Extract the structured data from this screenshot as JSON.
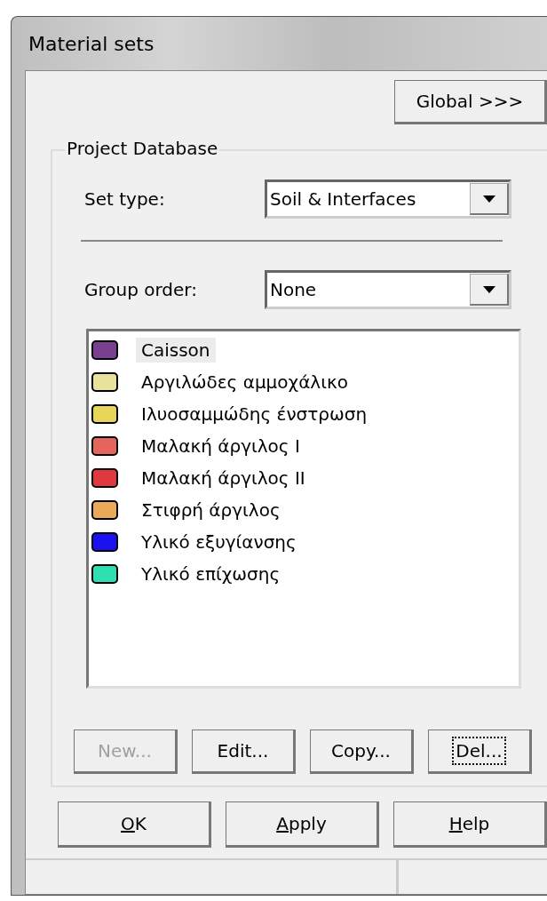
{
  "window": {
    "title": "Material sets"
  },
  "global_button": {
    "label": "Global >>>"
  },
  "group": {
    "title": "Project Database"
  },
  "set_type": {
    "label": "Set type:",
    "value": "Soil & Interfaces"
  },
  "group_order": {
    "label": "Group order:",
    "value": "None"
  },
  "materials": [
    {
      "name": "Caisson",
      "color": "#7b3f92",
      "selected": true
    },
    {
      "name": "Αργιλώδες αμμοχάλικο",
      "color": "#e8e29a",
      "selected": false
    },
    {
      "name": "Ιλυοσαμμώδης ένστρωση",
      "color": "#e8d65a",
      "selected": false
    },
    {
      "name": "Μαλακή άργιλος I",
      "color": "#e5645c",
      "selected": false
    },
    {
      "name": "Μαλακή άργιλος II",
      "color": "#e0383e",
      "selected": false
    },
    {
      "name": "Στιφρή άργιλος",
      "color": "#eba95a",
      "selected": false
    },
    {
      "name": "Υλικό εξυγίανσης",
      "color": "#1a10f0",
      "selected": false
    },
    {
      "name": "Υλικό επίχωσης",
      "color": "#2ee0b0",
      "selected": false
    }
  ],
  "list_buttons": [
    {
      "label": "New...",
      "disabled": true,
      "focused": false
    },
    {
      "label": "Edit...",
      "disabled": false,
      "focused": false
    },
    {
      "label": "Copy...",
      "disabled": false,
      "focused": false
    },
    {
      "label": "Del...",
      "disabled": false,
      "focused": true
    }
  ],
  "dialog_buttons": [
    {
      "label": "OK"
    },
    {
      "label": "Apply"
    },
    {
      "label": "Help"
    }
  ]
}
